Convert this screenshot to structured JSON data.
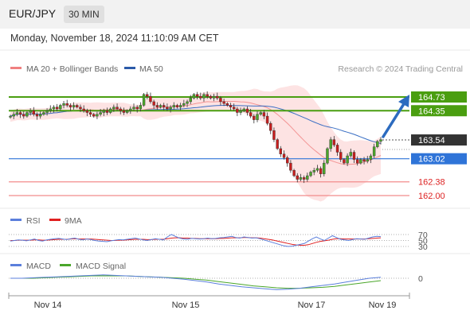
{
  "header": {
    "symbol": "EUR/JPY",
    "timeframe": "30 MIN"
  },
  "datetime": "Monday, November 18, 2024 11:10:09 AM CET",
  "credit": "Research © 2024 Trading Central",
  "colors": {
    "bollinger": "#f08080",
    "band_fill": "#fde3e3",
    "ma50": "#3a6fc4",
    "resistance": "#4a9e10",
    "pivot": "#2f74d8",
    "support": "#f28c8c",
    "last": "#333333",
    "rsi": "#5b7fdc",
    "rsi_ma": "#e02020",
    "macd": "#5b7fdc",
    "macd_signal": "#4aa62a",
    "candle_up": "#4aa62a",
    "candle_down": "#c81e1e",
    "arrow": "#2c6bbf"
  },
  "chart_data": [
    {
      "type": "line",
      "panel": "price",
      "legend": [
        {
          "name": "MA 20 + Bollinger Bands",
          "color": "#f08080"
        },
        {
          "name": "MA 50",
          "color": "#2b5aa8"
        }
      ],
      "x": [
        "Nov 14",
        "Nov 15",
        "Nov 17",
        "Nov 19"
      ],
      "levels": [
        {
          "value": 164.73,
          "label": "164.73",
          "kind": "resistance"
        },
        {
          "value": 164.35,
          "label": "164.35",
          "kind": "resistance"
        },
        {
          "value": 163.54,
          "label": "163.54",
          "kind": "last"
        },
        {
          "value": 163.02,
          "label": "163.02",
          "kind": "pivot"
        },
        {
          "value": 162.38,
          "label": "162.38",
          "kind": "support"
        },
        {
          "value": 162.0,
          "label": "162.00",
          "kind": "support"
        }
      ],
      "close": [
        164.2,
        164.25,
        164.3,
        164.25,
        164.2,
        164.3,
        164.35,
        164.25,
        164.2,
        164.25,
        164.3,
        164.35,
        164.4,
        164.45,
        164.4,
        164.5,
        164.55,
        164.5,
        164.45,
        164.5,
        164.45,
        164.4,
        164.35,
        164.3,
        164.25,
        164.2,
        164.25,
        164.3,
        164.35,
        164.3,
        164.4,
        164.45,
        164.4,
        164.35,
        164.3,
        164.35,
        164.4,
        164.45,
        164.4,
        164.5,
        164.8,
        164.75,
        164.6,
        164.5,
        164.45,
        164.5,
        164.45,
        164.4,
        164.45,
        164.5,
        164.45,
        164.5,
        164.55,
        164.6,
        164.7,
        164.8,
        164.75,
        164.7,
        164.8,
        164.75,
        164.7,
        164.75,
        164.7,
        164.6,
        164.55,
        164.5,
        164.45,
        164.4,
        164.3,
        164.35,
        164.4,
        164.3,
        164.2,
        164.1,
        164.25,
        164.3,
        164.2,
        164.0,
        163.8,
        163.55,
        163.3,
        163.15,
        163.05,
        162.9,
        162.7,
        162.55,
        162.45,
        162.5,
        162.45,
        162.55,
        162.65,
        162.7,
        162.75,
        162.6,
        162.9,
        163.3,
        163.55,
        163.4,
        163.2,
        163.0,
        162.9,
        163.1,
        163.2,
        163.0,
        162.9,
        163.0,
        162.95,
        163.0,
        163.1,
        163.35,
        163.5,
        163.55
      ]
    },
    {
      "type": "line",
      "panel": "rsi",
      "legend": [
        {
          "name": "RSI",
          "color": "#5b7fdc"
        },
        {
          "name": "9MA",
          "color": "#e02020"
        }
      ],
      "y_ticks": [
        70,
        50,
        30
      ],
      "series": [
        {
          "name": "RSI",
          "values": [
            48,
            50,
            52,
            51,
            49,
            52,
            55,
            50,
            48,
            52,
            54,
            56,
            57,
            55,
            53,
            56,
            58,
            54,
            52,
            55,
            53,
            50,
            48,
            47,
            46,
            49,
            51,
            53,
            52,
            54,
            56,
            58,
            55,
            52,
            50,
            53,
            56,
            54,
            52,
            62,
            70,
            64,
            58,
            55,
            54,
            57,
            56,
            55,
            56,
            58,
            56,
            57,
            59,
            60,
            62,
            64,
            60,
            58,
            62,
            60,
            58,
            59,
            56,
            52,
            48,
            44,
            40,
            36,
            32,
            30,
            31,
            34,
            37,
            40,
            48,
            56,
            62,
            55,
            50,
            58,
            66,
            60,
            54,
            52,
            50,
            53,
            56,
            55,
            54,
            58,
            62,
            64,
            63
          ]
        },
        {
          "name": "9MA",
          "values": [
            50,
            50,
            51,
            51,
            51,
            51,
            52,
            52,
            51,
            51,
            52,
            53,
            54,
            54,
            54,
            55,
            56,
            55,
            55,
            55,
            55,
            54,
            53,
            52,
            51,
            50,
            50,
            51,
            51,
            52,
            53,
            54,
            54,
            54,
            53,
            53,
            54,
            54,
            54,
            56,
            58,
            59,
            59,
            58,
            58,
            57,
            57,
            56,
            56,
            56,
            56,
            56,
            57,
            57,
            58,
            59,
            59,
            59,
            60,
            60,
            59,
            59,
            58,
            56,
            54,
            52,
            49,
            46,
            43,
            40,
            37,
            35,
            34,
            34,
            36,
            40,
            44,
            47,
            49,
            51,
            54,
            56,
            56,
            55,
            55,
            55,
            55,
            55,
            55,
            56,
            57,
            58,
            59
          ]
        }
      ]
    },
    {
      "type": "line",
      "panel": "macd",
      "legend": [
        {
          "name": "MACD",
          "color": "#5b7fdc"
        },
        {
          "name": "MACD Signal",
          "color": "#4aa62a"
        }
      ],
      "y_ticks": [
        0
      ],
      "series": [
        {
          "name": "MACD",
          "values": [
            0.0,
            0.0,
            0.01,
            0.02,
            0.03,
            0.04,
            0.05,
            0.06,
            0.07,
            0.06,
            0.05,
            0.04,
            0.03,
            0.02,
            0.0,
            -0.02,
            -0.05,
            -0.08,
            -0.12,
            -0.15,
            -0.18,
            -0.2,
            -0.22,
            -0.24,
            -0.23,
            -0.21,
            -0.18,
            -0.15,
            -0.12,
            -0.08,
            -0.04,
            0.0,
            0.02
          ]
        },
        {
          "name": "MACD Signal",
          "values": [
            0.0,
            0.0,
            0.0,
            0.01,
            0.02,
            0.03,
            0.04,
            0.05,
            0.05,
            0.05,
            0.05,
            0.04,
            0.03,
            0.02,
            0.01,
            0.0,
            -0.02,
            -0.04,
            -0.07,
            -0.1,
            -0.13,
            -0.16,
            -0.18,
            -0.2,
            -0.21,
            -0.21,
            -0.2,
            -0.19,
            -0.17,
            -0.14,
            -0.11,
            -0.08,
            -0.05
          ]
        }
      ]
    }
  ]
}
